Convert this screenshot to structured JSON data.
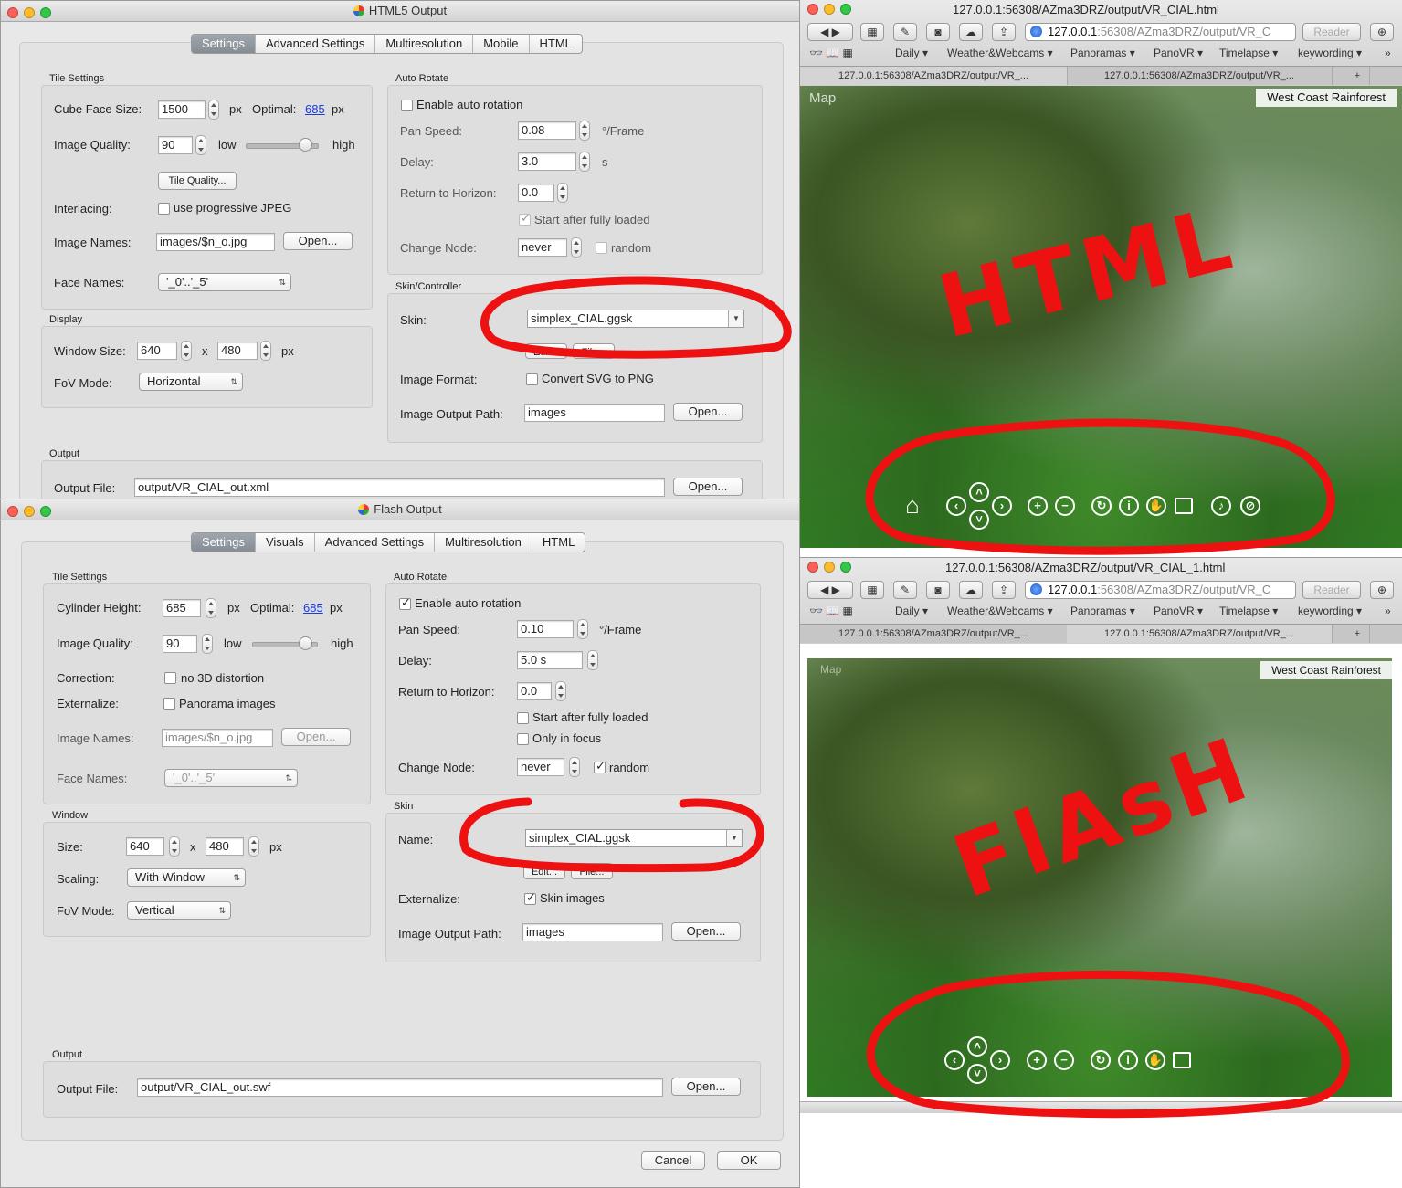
{
  "html5": {
    "title": "HTML5 Output",
    "tabs": [
      "Settings",
      "Advanced Settings",
      "Multiresolution",
      "Mobile",
      "HTML"
    ],
    "tile": {
      "group": "Tile Settings",
      "cube_label": "Cube Face Size:",
      "cube_value": "1500",
      "px": "px",
      "optimal_label": "Optimal:",
      "optimal_value": "685",
      "quality_label": "Image Quality:",
      "quality_value": "90",
      "low": "low",
      "high": "high",
      "tile_quality_btn": "Tile Quality...",
      "interlacing_label": "Interlacing:",
      "progressive": "use progressive JPEG",
      "names_label": "Image Names:",
      "names_value": "images/$n_o.jpg",
      "open": "Open...",
      "face_label": "Face Names:",
      "face_value": "'_0'..'_5'"
    },
    "display": {
      "group": "Display",
      "size_label": "Window Size:",
      "w": "640",
      "x": "x",
      "h": "480",
      "px": "px",
      "fov_label": "FoV Mode:",
      "fov_value": "Horizontal"
    },
    "auto": {
      "group": "Auto Rotate",
      "enable": "Enable auto rotation",
      "pan_label": "Pan Speed:",
      "pan_value": "0.08",
      "pan_unit": "°/Frame",
      "delay_label": "Delay:",
      "delay_value": "3.0",
      "delay_unit": "s",
      "horizon_label": "Return to Horizon:",
      "horizon_value": "0.0",
      "start_loaded": "Start after fully loaded",
      "change_label": "Change Node:",
      "change_value": "never",
      "random": "random"
    },
    "skin": {
      "group": "Skin/Controller",
      "skin_label": "Skin:",
      "skin_value": "simplex_CIAL.ggsk",
      "edit": "Edit...",
      "file": "File...",
      "format_label": "Image Format:",
      "convert": "Convert SVG to PNG",
      "path_label": "Image Output Path:",
      "path_value": "images",
      "open": "Open..."
    },
    "output": {
      "group": "Output",
      "file_label": "Output File:",
      "file_value": "output/VR_CIAL_out.xml",
      "open": "Open..."
    }
  },
  "flash": {
    "title": "Flash Output",
    "tabs": [
      "Settings",
      "Visuals",
      "Advanced Settings",
      "Multiresolution",
      "HTML"
    ],
    "tile": {
      "group": "Tile Settings",
      "cyl_label": "Cylinder Height:",
      "cyl_value": "685",
      "px": "px",
      "optimal_label": "Optimal:",
      "optimal_value": "685",
      "quality_label": "Image Quality:",
      "quality_value": "90",
      "low": "low",
      "high": "high",
      "correction_label": "Correction:",
      "no3d": "no 3D distortion",
      "externalize_label": "Externalize:",
      "panorama_images": "Panorama images",
      "names_label": "Image Names:",
      "names_value": "images/$n_o.jpg",
      "open": "Open...",
      "face_label": "Face Names:",
      "face_value": "'_0'..'_5'"
    },
    "window": {
      "group": "Window",
      "size_label": "Size:",
      "w": "640",
      "x": "x",
      "h": "480",
      "px": "px",
      "scaling_label": "Scaling:",
      "scaling_value": "With Window",
      "fov_label": "FoV Mode:",
      "fov_value": "Vertical"
    },
    "auto": {
      "group": "Auto Rotate",
      "enable": "Enable auto rotation",
      "pan_label": "Pan Speed:",
      "pan_value": "0.10",
      "pan_unit": "°/Frame",
      "delay_label": "Delay:",
      "delay_value": "5.0 s",
      "horizon_label": "Return to Horizon:",
      "horizon_value": "0.0",
      "start_loaded": "Start after fully loaded",
      "only_focus": "Only in focus",
      "change_label": "Change Node:",
      "change_value": "never",
      "random": "random"
    },
    "skin": {
      "group": "Skin",
      "name_label": "Name:",
      "name_value": "simplex_CIAL.ggsk",
      "edit": "Edit...",
      "file": "File...",
      "externalize_label": "Externalize:",
      "skin_images": "Skin images",
      "path_label": "Image Output Path:",
      "path_value": "images",
      "open": "Open..."
    },
    "output": {
      "group": "Output",
      "file_label": "Output File:",
      "file_value": "output/VR_CIAL_out.swf",
      "open": "Open..."
    },
    "cancel": "Cancel",
    "ok": "OK"
  },
  "browser_top": {
    "title": "127.0.0.1:56308/AZma3DRZ/output/VR_CIAL.html",
    "url_host": "127.0.0.1",
    "url_path": ":56308/AZma3DRZ/output/VR_C",
    "reader": "Reader",
    "bookmarks": [
      "Daily ▾",
      "Weather&Webcams ▾",
      "Panoramas ▾",
      "PanoVR ▾",
      "Timelapse ▾",
      "keywording ▾"
    ],
    "tabs": [
      "127.0.0.1:56308/AZma3DRZ/output/VR_...",
      "127.0.0.1:56308/AZma3DRZ/output/VR_..."
    ],
    "map": "Map",
    "location": "West Coast Rainforest",
    "annotation": "HTML"
  },
  "browser_bottom": {
    "title": "127.0.0.1:56308/AZma3DRZ/output/VR_CIAL_1.html",
    "url_host": "127.0.0.1",
    "url_path": ":56308/AZma3DRZ/output/VR_C",
    "reader": "Reader",
    "bookmarks": [
      "Daily ▾",
      "Weather&Webcams ▾",
      "Panoramas ▾",
      "PanoVR ▾",
      "Timelapse ▾",
      "keywording ▾"
    ],
    "tabs": [
      "127.0.0.1:56308/AZma3DRZ/output/VR_...",
      "127.0.0.1:56308/AZma3DRZ/output/VR_..."
    ],
    "map": "Map",
    "location": "West Coast Rainforest",
    "annotation": "FlAsH"
  },
  "colors": {
    "annotation_red": "#ee1111",
    "selected_tab": "#8d949c",
    "link": "#1a3cdc"
  }
}
